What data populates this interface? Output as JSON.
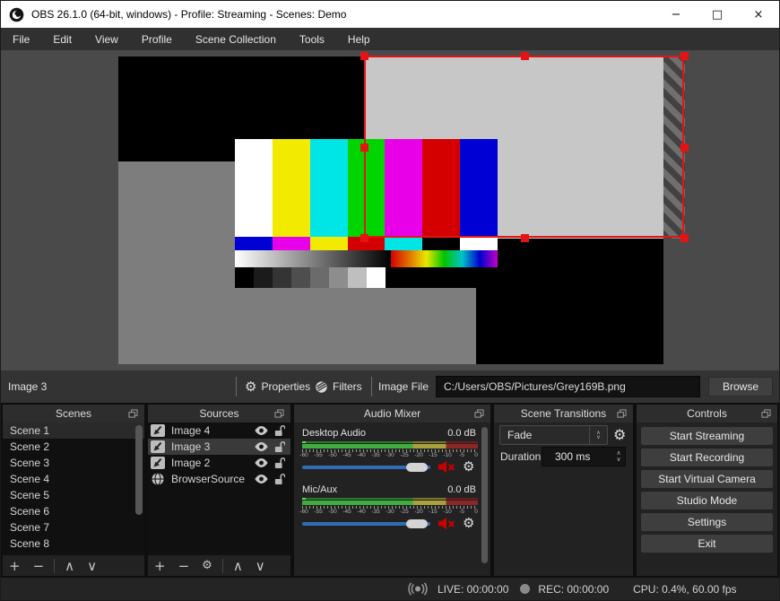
{
  "window": {
    "title": "OBS 26.1.0 (64-bit, windows) - Profile: Streaming - Scenes: Demo"
  },
  "icons": {
    "minimize": "−",
    "maximize": "□",
    "close": "×",
    "plus": "+",
    "minus": "−",
    "gear": "⚙",
    "up": "∧",
    "down": "∨"
  },
  "menubar": {
    "items": [
      "File",
      "Edit",
      "View",
      "Profile",
      "Scene Collection",
      "Tools",
      "Help"
    ]
  },
  "toolbar": {
    "selected_source": "Image 3",
    "properties": "Properties",
    "filters": "Filters",
    "image_file_label": "Image File",
    "image_file_value": "C:/Users/OBS/Pictures/Grey169B.png",
    "browse": "Browse"
  },
  "scenes": {
    "title": "Scenes",
    "selected_index": 0,
    "items": [
      "Scene 1",
      "Scene 2",
      "Scene 3",
      "Scene 4",
      "Scene 5",
      "Scene 6",
      "Scene 7",
      "Scene 8"
    ]
  },
  "sources": {
    "title": "Sources",
    "items": [
      {
        "name": "Image 4",
        "type": "image",
        "visible": true,
        "locked": false,
        "selected": false
      },
      {
        "name": "Image 3",
        "type": "image",
        "visible": true,
        "locked": false,
        "selected": true
      },
      {
        "name": "Image 2",
        "type": "image",
        "visible": true,
        "locked": false,
        "selected": false
      },
      {
        "name": "BrowserSource",
        "type": "browser",
        "visible": true,
        "locked": false,
        "selected": false
      }
    ]
  },
  "mixer": {
    "title": "Audio Mixer",
    "ticks": [
      "-60",
      "-55",
      "-50",
      "-45",
      "-40",
      "-35",
      "-30",
      "-25",
      "-20",
      "-15",
      "-10",
      "-5",
      "0"
    ],
    "channels": [
      {
        "name": "Desktop Audio",
        "db": "0.0 dB",
        "muted": true
      },
      {
        "name": "Mic/Aux",
        "db": "0.0 dB",
        "muted": true
      }
    ]
  },
  "transitions": {
    "title": "Scene Transitions",
    "selected": "Fade",
    "duration_label": "Duration",
    "duration_value": "300 ms"
  },
  "controls": {
    "title": "Controls",
    "buttons": [
      "Start Streaming",
      "Start Recording",
      "Start Virtual Camera",
      "Studio Mode",
      "Settings",
      "Exit"
    ]
  },
  "statusbar": {
    "live": "LIVE: 00:00:00",
    "rec": "REC: 00:00:00",
    "cpu": "CPU: 0.4%, 60.00 fps"
  },
  "colors": {
    "selection_red": "#e51414",
    "slider_blue": "#2e6db4",
    "meter_green": "#3fae3f",
    "meter_yellow": "#a8a23a",
    "meter_red": "#8d2727",
    "titlebar_bg": "#ffffff",
    "selected_source_gray": "#c7c7c7",
    "canvas_gray": "#7d7d7d"
  }
}
